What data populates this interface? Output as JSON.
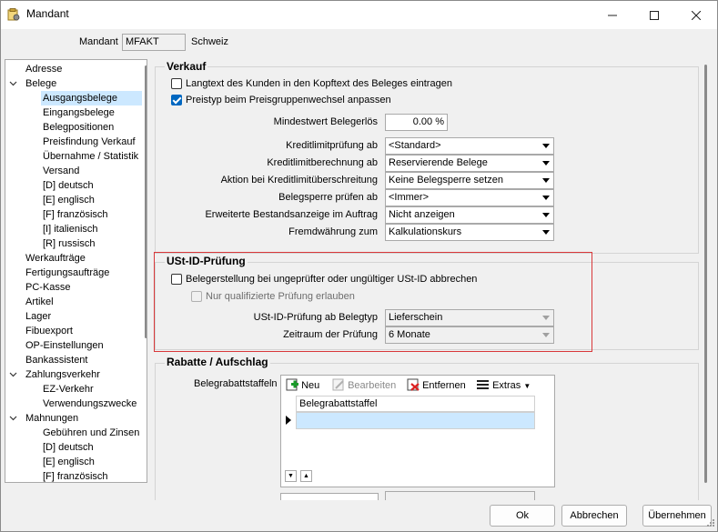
{
  "window": {
    "title": "Mandant"
  },
  "header": {
    "mandant_label": "Mandant",
    "mandant_value": "MFAKT",
    "mandant_name": "Schweiz"
  },
  "tree": {
    "items": [
      {
        "label": "Adresse",
        "level": 0,
        "expandable": false
      },
      {
        "label": "Belege",
        "level": 0,
        "expandable": true
      },
      {
        "label": "Ausgangsbelege",
        "level": 1,
        "selected": true
      },
      {
        "label": "Eingangsbelege",
        "level": 1
      },
      {
        "label": "Belegpositionen",
        "level": 1
      },
      {
        "label": "Preisfindung Verkauf",
        "level": 1
      },
      {
        "label": "Übernahme / Statistik",
        "level": 1
      },
      {
        "label": "Versand",
        "level": 1
      },
      {
        "label": "[D] deutsch",
        "level": 1
      },
      {
        "label": "[E] englisch",
        "level": 1
      },
      {
        "label": "[F] französisch",
        "level": 1
      },
      {
        "label": "[I] italienisch",
        "level": 1
      },
      {
        "label": "[R] russisch",
        "level": 1
      },
      {
        "label": "Werkaufträge",
        "level": 0
      },
      {
        "label": "Fertigungsaufträge",
        "level": 0
      },
      {
        "label": "PC-Kasse",
        "level": 0
      },
      {
        "label": "Artikel",
        "level": 0
      },
      {
        "label": "Lager",
        "level": 0
      },
      {
        "label": "Fibuexport",
        "level": 0
      },
      {
        "label": "OP-Einstellungen",
        "level": 0
      },
      {
        "label": "Bankassistent",
        "level": 0
      },
      {
        "label": "Zahlungsverkehr",
        "level": 0,
        "expandable": true
      },
      {
        "label": "EZ-Verkehr",
        "level": 1
      },
      {
        "label": "Verwendungszwecke",
        "level": 1
      },
      {
        "label": "Mahnungen",
        "level": 0,
        "expandable": true
      },
      {
        "label": "Gebühren und Zinsen",
        "level": 1
      },
      {
        "label": "[D] deutsch",
        "level": 1
      },
      {
        "label": "[E] englisch",
        "level": 1
      },
      {
        "label": "[F] französisch",
        "level": 1
      }
    ]
  },
  "verkauf": {
    "title": "Verkauf",
    "cb_langtext": "Langtext des Kunden in den Kopftext des Beleges eintragen",
    "cb_preistyp": "Preistyp beim Preisgruppenwechsel anpassen",
    "mindestwert_label": "Mindestwert Belegerlös",
    "mindestwert_value": "0.00 %",
    "kreditlimitpruefung_label": "Kreditlimitprüfung ab",
    "kreditlimitpruefung_value": "<Standard>",
    "kreditlimitberechnung_label": "Kreditlimitberechnung ab",
    "kreditlimitberechnung_value": "Reservierende Belege",
    "aktion_label": "Aktion bei Kreditlimitüberschreitung",
    "aktion_value": "Keine Belegsperre setzen",
    "belegsperre_label": "Belegsperre prüfen ab",
    "belegsperre_value": "<Immer>",
    "bestandsanzeige_label": "Erweiterte Bestandsanzeige im Auftrag",
    "bestandsanzeige_value": "Nicht anzeigen",
    "fremdwaehrung_label": "Fremdwährung zum",
    "fremdwaehrung_value": "Kalkulationskurs"
  },
  "ust": {
    "title": "USt-ID-Prüfung",
    "cb_abbrechen": "Belegerstellung bei ungeprüfter oder ungültiger USt-ID abbrechen",
    "cb_qualifiziert": "Nur qualifizierte Prüfung erlauben",
    "belegtyp_label": "USt-ID-Prüfung ab Belegtyp",
    "belegtyp_value": "Lieferschein",
    "zeitraum_label": "Zeitraum der Prüfung",
    "zeitraum_value": "6 Monate"
  },
  "rabatte": {
    "title": "Rabatte / Aufschlag",
    "staffeln_label": "Belegrabattstaffeln",
    "toolbar": {
      "neu": "Neu",
      "bearbeiten": "Bearbeiten",
      "entfernen": "Entfernen",
      "extras": "Extras"
    },
    "grid_header": "Belegrabattstaffel"
  },
  "footer": {
    "ok": "Ok",
    "abbrechen": "Abbrechen",
    "uebernehmen": "Übernehmen"
  },
  "colors": {
    "accent": "#0067c0",
    "highlight": "#d9383a",
    "selection": "#cce8ff"
  }
}
